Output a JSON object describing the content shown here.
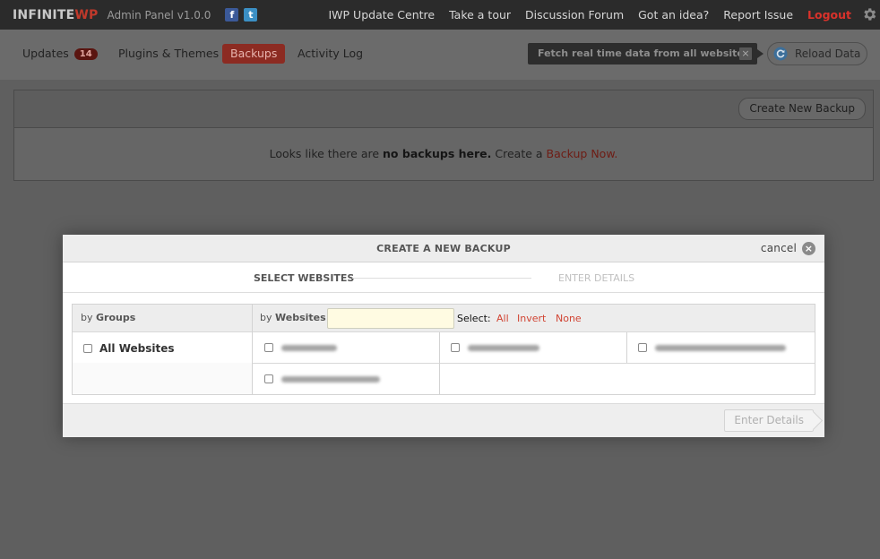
{
  "topbar": {
    "brand_part1": "INFINITE",
    "brand_part2": "WP",
    "subtitle": "Admin Panel v1.0.0",
    "facebook_glyph": "f",
    "twitter_glyph": "t",
    "nav": [
      "IWP Update Centre",
      "Take a tour",
      "Discussion Forum",
      "Got an idea?",
      "Report Issue"
    ],
    "logout": "Logout",
    "icons": {
      "settings": "gear-icon",
      "facebook": "facebook-icon",
      "twitter": "twitter-icon"
    }
  },
  "subbar": {
    "tabs": [
      {
        "label": "Updates",
        "badge": "14"
      },
      {
        "label": "Plugins & Themes"
      },
      {
        "label": "Backups",
        "active": true
      },
      {
        "label": "Activity Log"
      }
    ],
    "fetch_tip": "Fetch real time data from all websites",
    "fetch_close": "×",
    "reload": "Reload Data",
    "reload_icon": "refresh-icon"
  },
  "backups": {
    "create_button": "Create New Backup",
    "empty_prefix": "Looks like there are",
    "empty_bold": "no backups here.",
    "empty_middle": "Create a",
    "empty_link": "Backup Now."
  },
  "modal": {
    "title": "CREATE A NEW BACKUP",
    "cancel": "cancel",
    "cancel_glyph": "×",
    "step1": "SELECT WEBSITES",
    "step2": "ENTER DETAILS",
    "by_groups_prefix": "by",
    "by_groups": "Groups",
    "by_websites_prefix": "by",
    "by_websites": "Websites",
    "search_value": "",
    "select_label": "Select:",
    "select_all": "All",
    "select_invert": "Invert",
    "select_none": "None",
    "all_websites": "All Websites",
    "next_button": "Enter Details",
    "accent_color": "#d14433"
  }
}
